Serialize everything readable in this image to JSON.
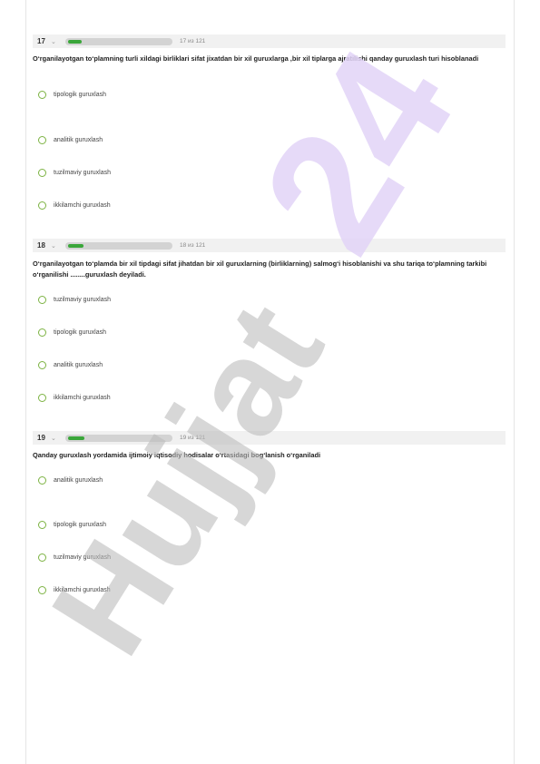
{
  "questions": [
    {
      "number": "17",
      "counter": "17 из 121",
      "progress": 0.13,
      "text": "O‘rganilayotgan to‘plamning turli xildagi birliklari sifat jixatdan bir xil guruxlarga ,bir xil tiplarga ajratilishi  qanday guruxlash turi hisoblanadi",
      "options": [
        "tipologik guruxlash",
        "analitik guruxlash",
        "tuzilmaviy guruxlash",
        "ikkilamchi guruxlash"
      ]
    },
    {
      "number": "18",
      "counter": "18 из 121",
      "progress": 0.14,
      "text": "O‘rganilayotgan to‘plamda bir xil tipdagi sifat jihatdan  bir xil  guruxlarning (birliklarning) salmog‘i hisoblanishi  va shu tariqa to‘plamning  tarkibi o‘rganilishi ........guruxlash deyiladi.",
      "options": [
        "tuzilmaviy guruxlash",
        "tipologik guruxlash",
        "analitik guruxlash",
        "ikkilamchi guruxlash"
      ]
    },
    {
      "number": "19",
      "counter": "19 из 121",
      "progress": 0.15,
      "text": "Qanday guruxlash yordamida ijtimoiy iqtisodiy hodisalar o‘rtasidagi bog‘lanish o‘rganiladi",
      "options": [
        "analitik guruxlash",
        "tipologik guruxlash",
        "tuzilmaviy guruxlash",
        "ikkilamchi guruxlash"
      ]
    }
  ],
  "watermark": {
    "top_text": "24",
    "bottom_text": "Hujjat",
    "top_color": "#e2d3f7",
    "bottom_color": "#bdbdbd"
  },
  "colors": {
    "header_bg": "#f1f1f1",
    "progress_fill": "#3aa63a",
    "radio_border": "#7cb342"
  }
}
